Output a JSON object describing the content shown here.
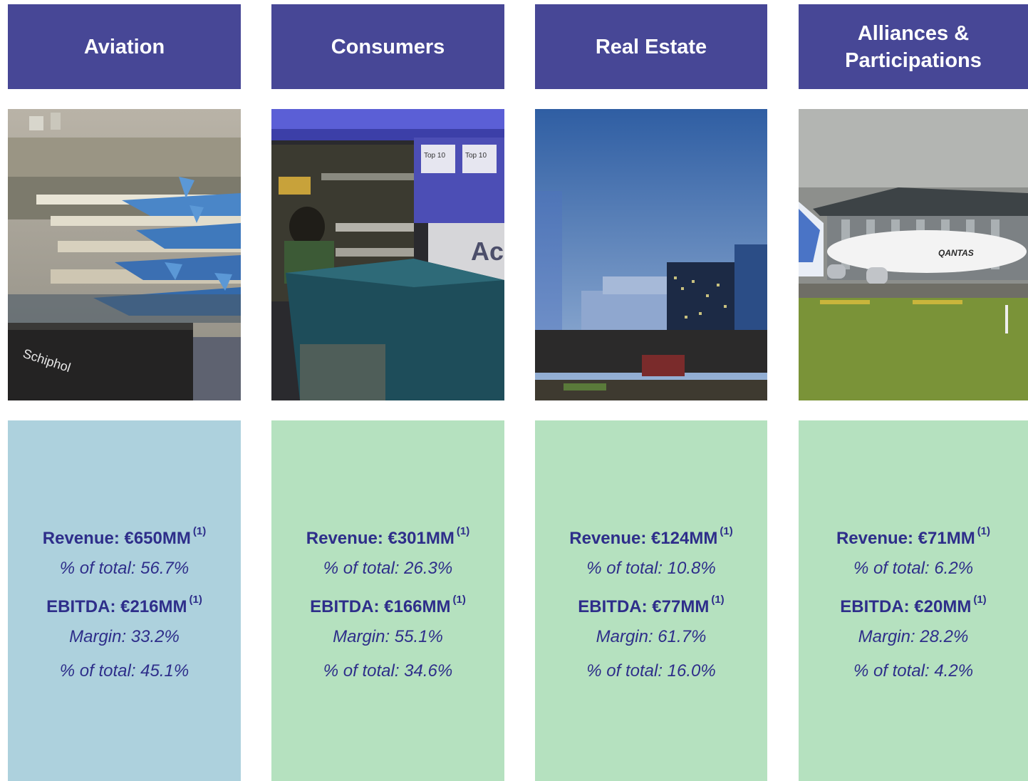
{
  "segments": [
    {
      "title": "Aviation",
      "revenue": "Revenue: €650MM",
      "revenue_note": "(1)",
      "revenue_share": "% of total: 56.7%",
      "ebitda": "EBITDA: €216MM",
      "ebitda_note": "(1)",
      "margin": "Margin: 33.2%",
      "ebitda_share": "% of total: 45.1%",
      "panel_color": "#add1dd"
    },
    {
      "title": "Consumers",
      "revenue": "Revenue: €301MM",
      "revenue_note": "(1)",
      "revenue_share": "% of total: 26.3%",
      "ebitda": "EBITDA: €166MM",
      "ebitda_note": "(1)",
      "margin": "Margin: 55.1%",
      "ebitda_share": "% of total: 34.6%",
      "panel_color": "#b5e1bf"
    },
    {
      "title": "Real Estate",
      "revenue": "Revenue: €124MM",
      "revenue_note": "(1)",
      "revenue_share": "% of total: 10.8%",
      "ebitda": "EBITDA: €77MM",
      "ebitda_note": "(1)",
      "margin": "Margin: 61.7%",
      "ebitda_share": "% of total: 16.0%",
      "panel_color": "#b5e1bf"
    },
    {
      "title": "Alliances & Participations",
      "revenue": "Revenue: €71MM",
      "revenue_note": "(1)",
      "revenue_share": "% of total: 6.2%",
      "ebitda": "EBITDA: €20MM",
      "ebitda_note": "(1)",
      "margin": "Margin: 28.2%",
      "ebitda_share": "% of total: 4.2%",
      "panel_color": "#b5e1bf"
    }
  ],
  "photo_labels": {
    "aviation_sign": "Schiphol",
    "consumers_sign": "Acc",
    "consumers_shelf_1": "Top 10",
    "consumers_shelf_2": "Top 10",
    "alliances_airline": "QANTAS"
  },
  "colors": {
    "header_bg": "#474796",
    "header_text": "#ffffff",
    "stat_text": "#2e2e8a"
  }
}
